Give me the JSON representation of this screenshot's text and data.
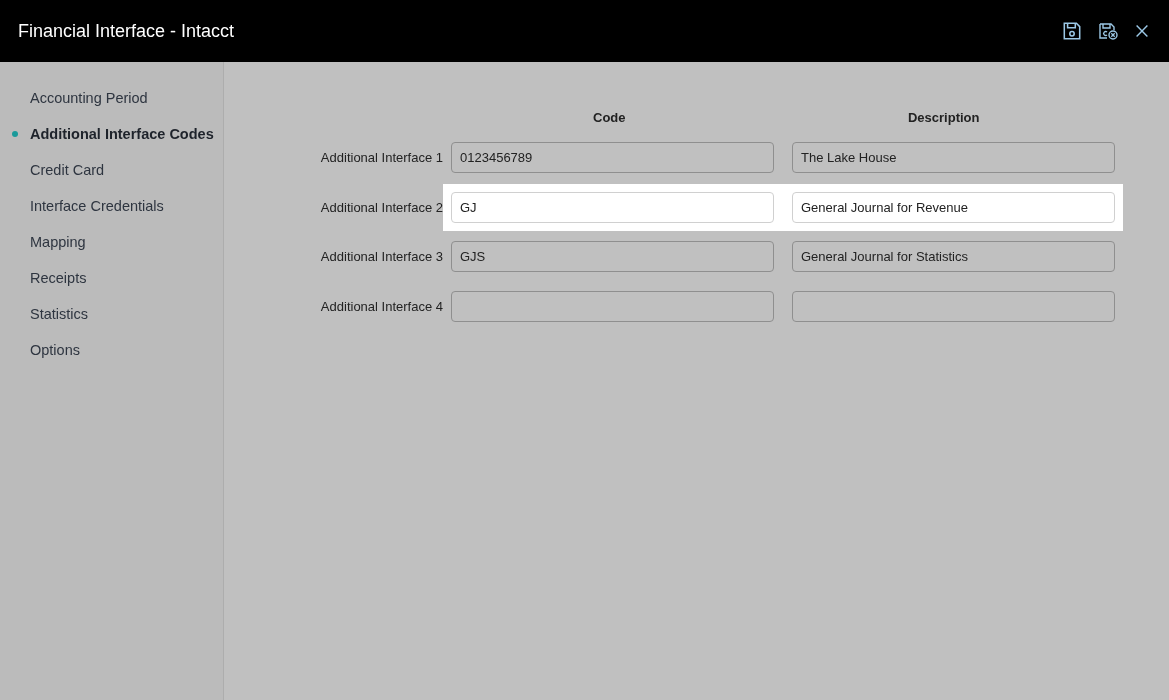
{
  "window": {
    "title": "Financial Interface - Intacct"
  },
  "sidebar": {
    "items": [
      {
        "label": "Accounting Period",
        "selected": false
      },
      {
        "label": "Additional Interface Codes",
        "selected": true
      },
      {
        "label": "Credit Card",
        "selected": false
      },
      {
        "label": "Interface Credentials",
        "selected": false
      },
      {
        "label": "Mapping",
        "selected": false
      },
      {
        "label": "Receipts",
        "selected": false
      },
      {
        "label": "Statistics",
        "selected": false
      },
      {
        "label": "Options",
        "selected": false
      }
    ]
  },
  "table": {
    "columns": [
      "Code",
      "Description"
    ],
    "rows": [
      {
        "label": "Additional Interface 1",
        "code": "0123456789",
        "description": "The Lake House",
        "highlighted": false
      },
      {
        "label": "Additional Interface 2",
        "code": "GJ",
        "description": "General Journal for Revenue",
        "highlighted": true
      },
      {
        "label": "Additional Interface 3",
        "code": "GJS",
        "description": "General Journal for Statistics",
        "highlighted": false
      },
      {
        "label": "Additional Interface 4",
        "code": "",
        "description": "",
        "highlighted": false
      }
    ]
  }
}
